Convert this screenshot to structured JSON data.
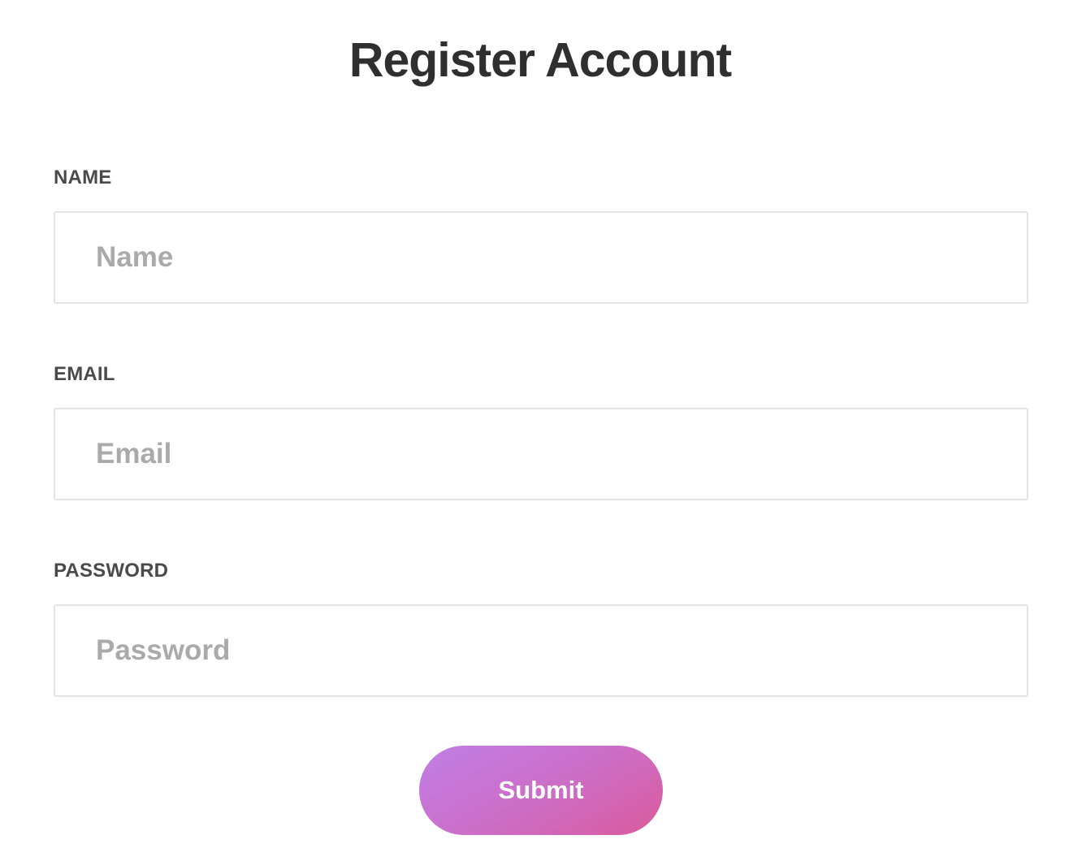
{
  "page": {
    "title": "Register Account"
  },
  "form": {
    "fields": [
      {
        "label": "NAME",
        "placeholder": "Name",
        "value": ""
      },
      {
        "label": "EMAIL",
        "placeholder": "Email",
        "value": ""
      },
      {
        "label": "PASSWORD",
        "placeholder": "Password",
        "value": ""
      }
    ],
    "submit_label": "Submit"
  },
  "colors": {
    "title_text": "#2f2f2f",
    "label_text": "#4a4a4a",
    "placeholder_text": "#aaaaaa",
    "input_border": "#e3e3e3",
    "button_gradient_start": "#c07fe6",
    "button_gradient_end": "#da5b9c",
    "button_text": "#ffffff"
  }
}
